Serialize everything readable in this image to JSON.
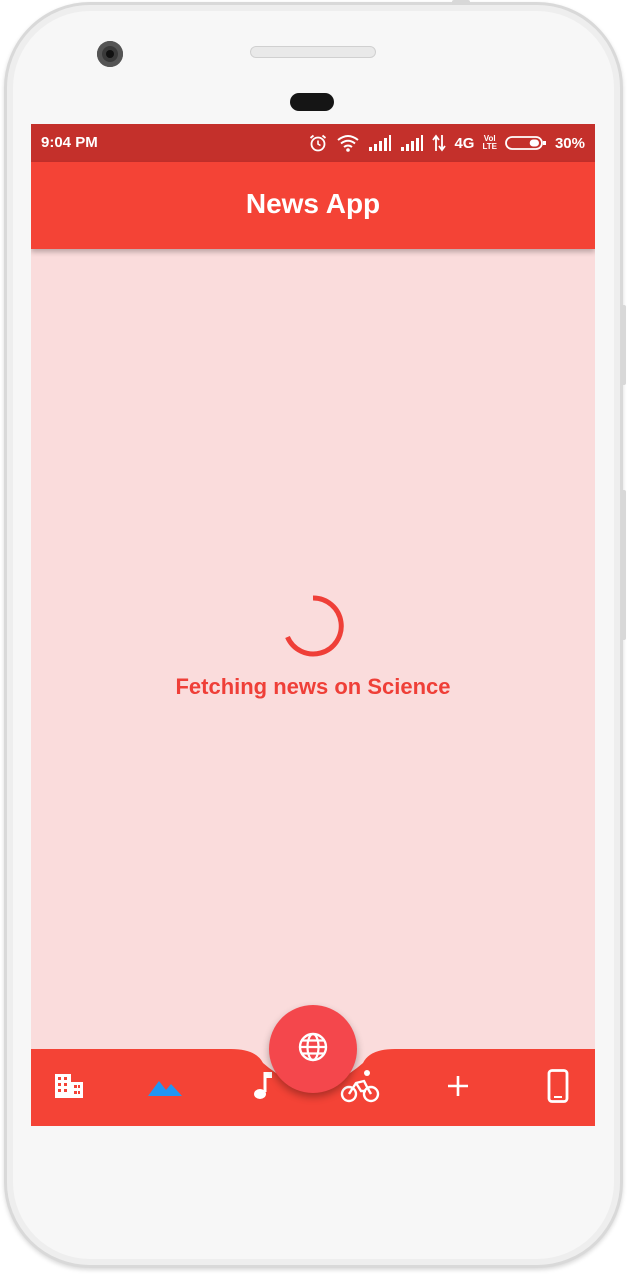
{
  "status_bar": {
    "time": "9:04 PM",
    "network": "4G",
    "volte_top": "Vol",
    "volte_bottom": "LTE",
    "battery_percent": "30%",
    "battery_level": 0.3,
    "icons": [
      "alarm-icon",
      "wifi-icon",
      "signal-icon",
      "signal-icon",
      "data-arrows-icon",
      "battery-icon"
    ]
  },
  "app_bar": {
    "title": "News App"
  },
  "content": {
    "loading_text": "Fetching news on Science"
  },
  "bottom_nav": {
    "items": [
      {
        "icon": "building-icon",
        "selected": false
      },
      {
        "icon": "landscape-icon",
        "selected": true
      },
      {
        "icon": "music-note-icon",
        "selected": false
      },
      {
        "icon": "bike-icon",
        "selected": false
      },
      {
        "icon": "plus-icon",
        "selected": false
      },
      {
        "icon": "smartphone-icon",
        "selected": false
      }
    ],
    "fab_icon": "globe-icon"
  },
  "colors": {
    "status_bar": "#c4302b",
    "app_bar": "#f44336",
    "background": "#fadcdc",
    "accent": "#ef3f38",
    "selected_icon": "#2196f3",
    "fab": "#f4474c"
  }
}
